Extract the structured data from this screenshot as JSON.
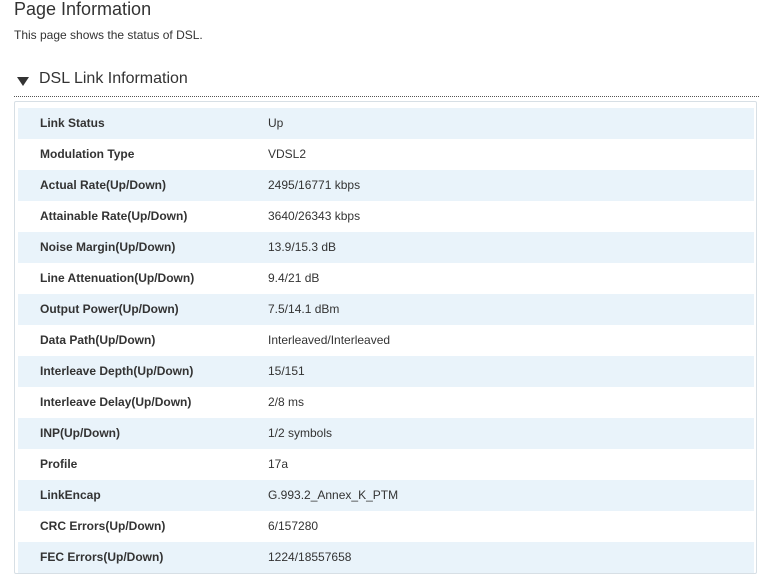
{
  "page": {
    "title": "Page Information",
    "description": "This page shows the status of DSL."
  },
  "section": {
    "title": "DSL Link Information",
    "toggle_icon": "triangle-down-icon",
    "expanded": true
  },
  "rows": [
    {
      "label": "Link Status",
      "value": "Up"
    },
    {
      "label": "Modulation Type",
      "value": "VDSL2"
    },
    {
      "label": "Actual Rate(Up/Down)",
      "value": "2495/16771 kbps"
    },
    {
      "label": "Attainable Rate(Up/Down)",
      "value": "3640/26343 kbps"
    },
    {
      "label": "Noise Margin(Up/Down)",
      "value": "13.9/15.3 dB"
    },
    {
      "label": "Line Attenuation(Up/Down)",
      "value": "9.4/21 dB"
    },
    {
      "label": "Output Power(Up/Down)",
      "value": "7.5/14.1 dBm"
    },
    {
      "label": "Data Path(Up/Down)",
      "value": "Interleaved/Interleaved"
    },
    {
      "label": "Interleave Depth(Up/Down)",
      "value": "15/151"
    },
    {
      "label": "Interleave Delay(Up/Down)",
      "value": "2/8 ms"
    },
    {
      "label": "INP(Up/Down)",
      "value": "1/2 symbols"
    },
    {
      "label": "Profile",
      "value": "17a"
    },
    {
      "label": "LinkEncap",
      "value": "G.993.2_Annex_K_PTM"
    },
    {
      "label": "CRC Errors(Up/Down)",
      "value": "6/157280"
    },
    {
      "label": "FEC Errors(Up/Down)",
      "value": "1224/18557658"
    }
  ],
  "colors": {
    "row_stripe": "#e9f3fa",
    "text": "#333333",
    "border": "#d7dfe5"
  }
}
